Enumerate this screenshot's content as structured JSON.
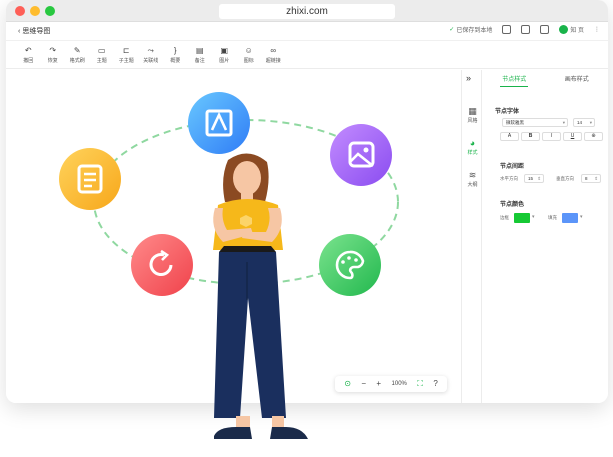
{
  "browser": {
    "url": "zhixi.com"
  },
  "header": {
    "back_label": "思维导图",
    "saved_label": "已保存到本地",
    "user_name": "知 页"
  },
  "toolbar": {
    "items": [
      {
        "icon": "undo-icon",
        "label": "撤回"
      },
      {
        "icon": "redo-icon",
        "label": "恢复"
      },
      {
        "icon": "format-painter-icon",
        "label": "格式刷"
      },
      {
        "icon": "topic-icon",
        "label": "主题"
      },
      {
        "icon": "subtopic-icon",
        "label": "子主题"
      },
      {
        "icon": "relation-line-icon",
        "label": "关联线"
      },
      {
        "icon": "summary-icon",
        "label": "概要"
      },
      {
        "icon": "note-icon",
        "label": "备注"
      },
      {
        "icon": "image-icon",
        "label": "图片"
      },
      {
        "icon": "sticker-icon",
        "label": "图标"
      },
      {
        "icon": "hyperlink-icon",
        "label": "超链接"
      }
    ]
  },
  "zoom": {
    "level": "100%"
  },
  "side_tabs": [
    {
      "icon": "style-grid-icon",
      "label": "风格",
      "active": false
    },
    {
      "icon": "palette-icon",
      "label": "样式",
      "active": true
    },
    {
      "icon": "outline-layers-icon",
      "label": "大纲",
      "active": false
    }
  ],
  "panel": {
    "tabs": [
      "节点样式",
      "画布样式"
    ],
    "font_section": "节点字体",
    "font_family": "微软雅黑",
    "font_size": "14",
    "format_buttons": [
      "A",
      "B",
      "I",
      "U",
      "⊕"
    ],
    "spacing_section": "节点间距",
    "horizontal_label": "水平方向",
    "horizontal_value": "15",
    "vertical_label": "垂直方向",
    "vertical_value": "8",
    "color_section": "节点颜色",
    "border_label": "边框",
    "fill_label": "填充"
  },
  "colors": {
    "accent": "#19b34a",
    "border_swatch": "#16c934",
    "fill_swatch": "#5b95f9"
  }
}
